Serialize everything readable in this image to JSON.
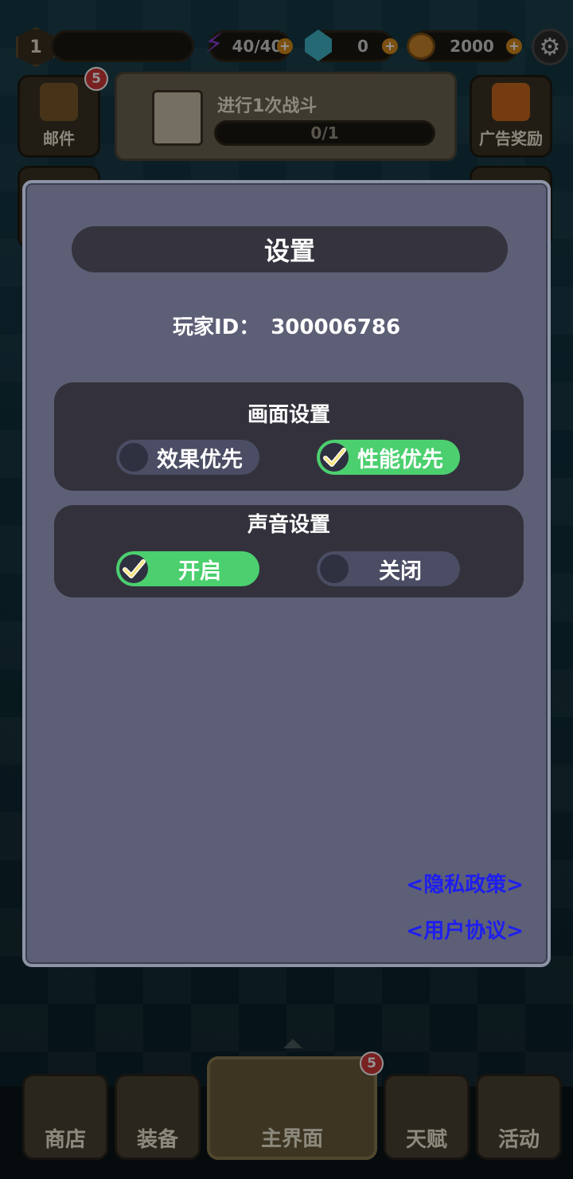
{
  "hud": {
    "level": "1",
    "energy": "40/40",
    "gems": "0",
    "coins": "2000"
  },
  "side_buttons": {
    "mail_label": "邮件",
    "mail_badge": "5",
    "ad_reward_label": "广告奖励"
  },
  "quest": {
    "title": "进行1次战斗",
    "progress": "0/1"
  },
  "settings": {
    "title": "设置",
    "player_id_label": "玩家ID：",
    "player_id_value": "300006786",
    "graphics": {
      "title": "画面设置",
      "option_effect": "效果优先",
      "option_performance": "性能优先",
      "selected": "性能优先"
    },
    "sound": {
      "title": "声音设置",
      "option_on": "开启",
      "option_off": "关闭",
      "selected": "开启"
    },
    "privacy_link": "<隐私政策>",
    "user_agreement_link": "<用户协议>"
  },
  "bottom_nav": {
    "shop": "商店",
    "equipment": "装备",
    "main": "主界面",
    "main_badge": "5",
    "talent": "天赋",
    "activity": "活动"
  },
  "colors": {
    "modal_bg": "#5d5f76",
    "section_bg": "#33323c",
    "toggle_on": "#4ccf6f",
    "link": "#1e1ef0"
  }
}
